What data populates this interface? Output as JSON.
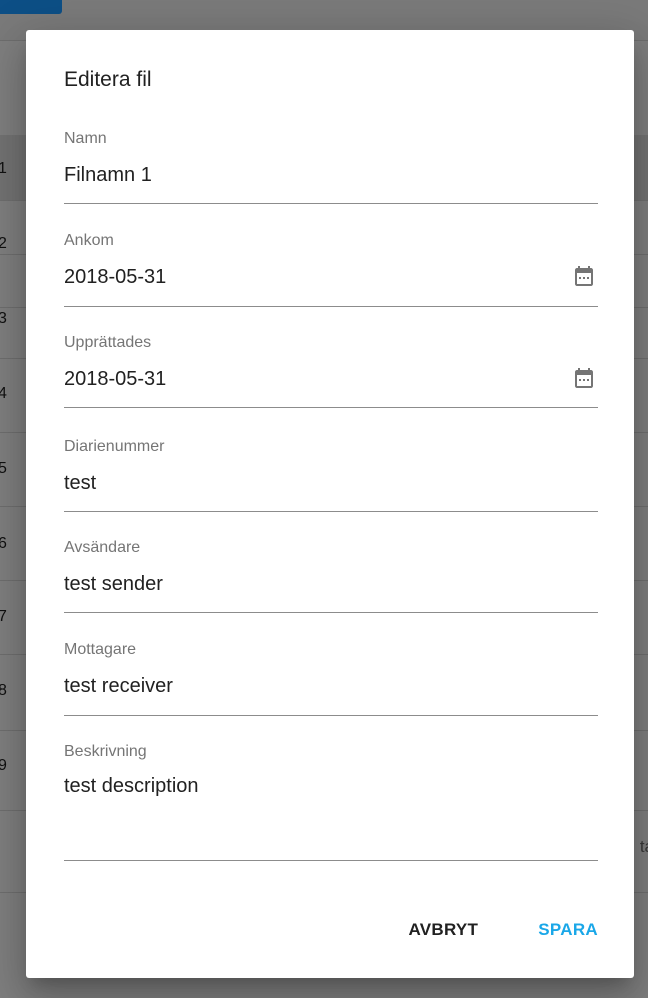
{
  "background": {
    "row_numbers": [
      "1",
      "2",
      "3",
      "4",
      "5",
      "6",
      "7",
      "8",
      "9"
    ],
    "cut_off_text": "ta"
  },
  "dialog": {
    "title": "Editera fil",
    "fields": {
      "name": {
        "label": "Namn",
        "value": "Filnamn 1"
      },
      "arrived": {
        "label": "Ankom",
        "value": "2018-05-31",
        "icon": "calendar-icon"
      },
      "created": {
        "label": "Upprättades",
        "value": "2018-05-31",
        "icon": "calendar-icon"
      },
      "registry_number": {
        "label": "Diarienummer",
        "value": "test"
      },
      "sender": {
        "label": "Avsändare",
        "value": "test sender"
      },
      "receiver": {
        "label": "Mottagare",
        "value": "test receiver"
      },
      "description": {
        "label": "Beskrivning",
        "value": "test description"
      }
    },
    "actions": {
      "cancel_label": "AVBRYT",
      "save_label": "SPARA"
    }
  },
  "colors": {
    "accent": "#1aa7e8",
    "overlay_bg": "#7f7f7f",
    "top_button": "#0d4f86"
  }
}
